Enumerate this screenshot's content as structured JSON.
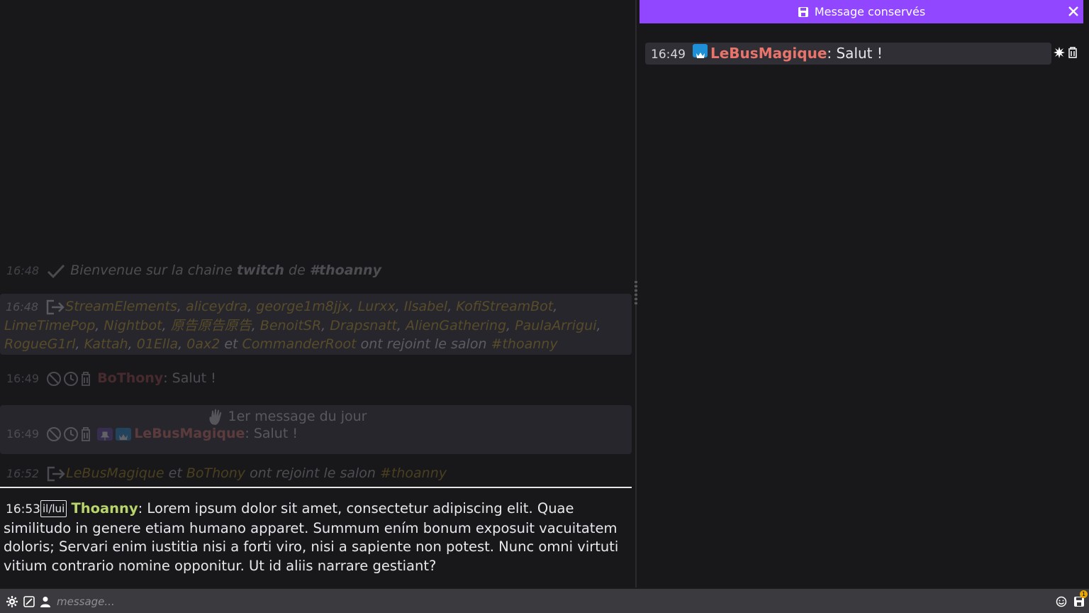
{
  "chat": {
    "welcome": {
      "time": "16:48",
      "text_prefix": "Bienvenue sur la chaine ",
      "text_bold1": "twitch",
      "text_mid": " de ",
      "text_bold2": "#thoanny"
    },
    "joined1": {
      "time": "16:48",
      "users": [
        "StreamElements",
        "aliceydra",
        "george1m8jjx",
        "Lurxx",
        "Ilsabel",
        "KofiStreamBot",
        "LimeTimePop",
        "Nightbot",
        "原告原告原告",
        "BenoitSR",
        "Drapsnatt",
        "AlienGathering",
        "PaulaArrigui",
        "RogueG1rl",
        "Kattah",
        "01Ella",
        "0ax2"
      ],
      "last_user": "CommanderRoot",
      "and_word": "et",
      "suffix": "ont rejoint le salon",
      "channel": "#thoanny"
    },
    "msg_bothony": {
      "time": "16:49",
      "user": "BoThony",
      "text": ": Salut !"
    },
    "first_msg": {
      "banner": "1er message du jour",
      "time": "16:49",
      "user": "LeBusMagique",
      "text": ": Salut !"
    },
    "joined2": {
      "time": "16:52",
      "user1": "LeBusMagique",
      "and_word": "et",
      "user2": "BoThony",
      "suffix": "ont rejoint le salon",
      "channel": "#thoanny"
    },
    "active": {
      "time": "16:53",
      "pronoun": "il/lui",
      "user": "Thoanny",
      "text": ": Lorem ipsum dolor sit amet, consectetur adipiscing elit. Quae similitudo in genere etiam humano apparet. Summum ením bonum exposuit vacuitatem doloris; Servari enim iustitia nisi a forti viro, nisi a sapiente non potest. Nunc omni virtuti vitium contrario nomine opponitur. Ut id aliis narrare gestiant?"
    }
  },
  "saved_panel": {
    "title": "Message conservés",
    "message": {
      "time": "16:49",
      "user": "LeBusMagique",
      "text": ": Salut !"
    }
  },
  "input": {
    "placeholder": "message...",
    "notif_count": "1"
  },
  "colors": {
    "accent": "#9147ff",
    "user_lebus": "#e8746b",
    "user_thoanny": "#b8d46b",
    "joined_names": "#c9a227"
  }
}
